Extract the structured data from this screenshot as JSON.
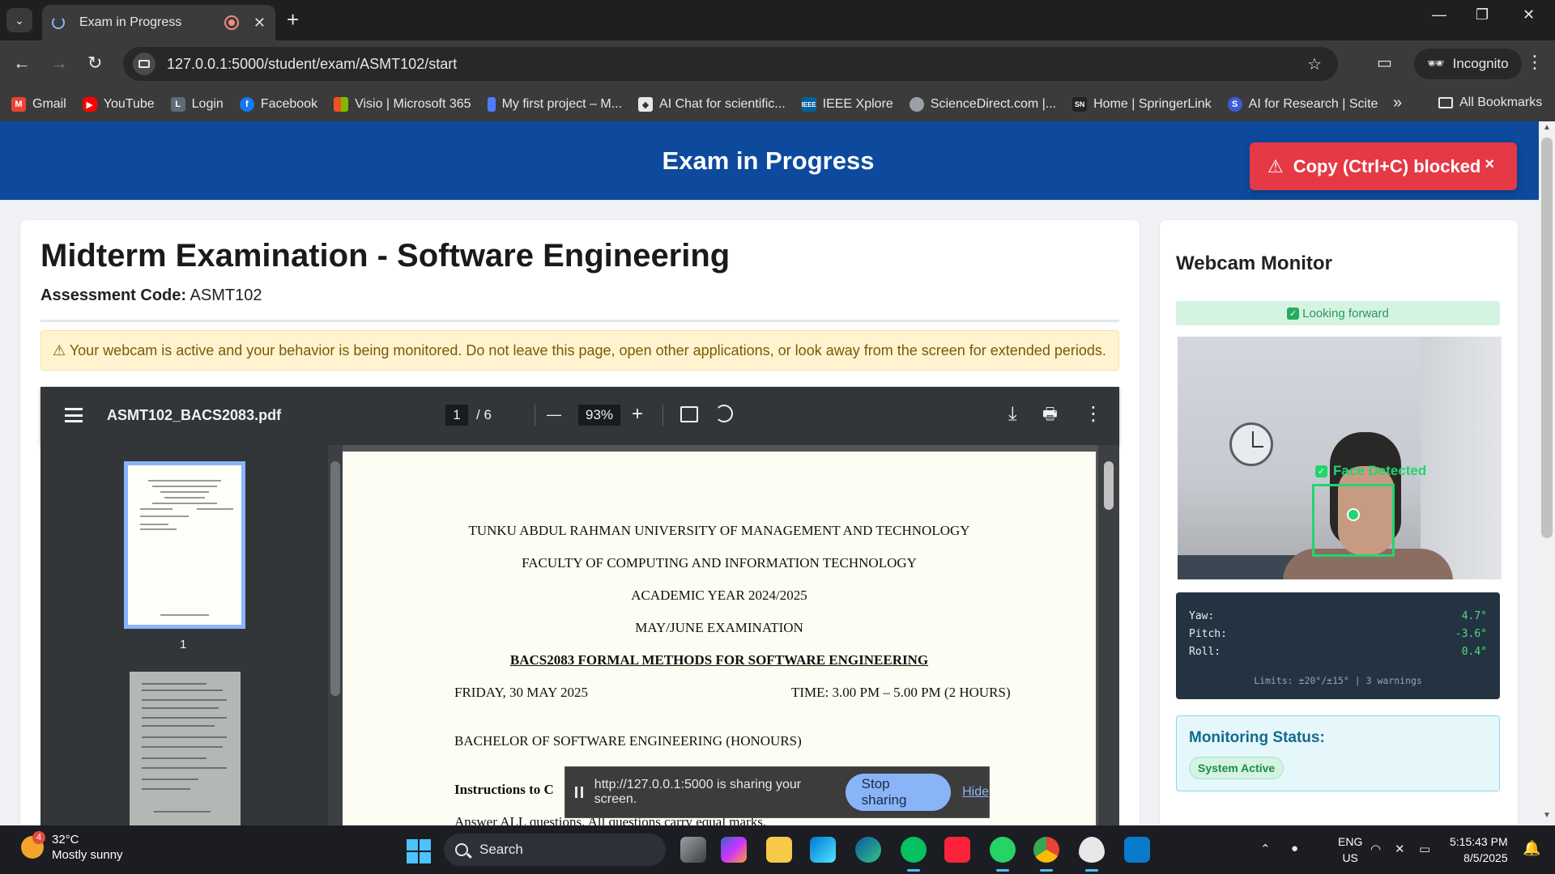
{
  "browser": {
    "tab_title": "Exam in Progress",
    "tab_close": "✕",
    "new_tab": "+",
    "url": "127.0.0.1:5000/student/exam/ASMT102/start",
    "incognito_label": "Incognito",
    "window_controls": [
      "—",
      "❐",
      "✕"
    ],
    "bookmarks": [
      {
        "label": "Gmail",
        "icon": "gmail-icon",
        "color": "#ea4335"
      },
      {
        "label": "YouTube",
        "icon": "youtube-icon",
        "color": "#ff0000"
      },
      {
        "label": "Login",
        "icon": "login-icon",
        "color": "#5f6b7a"
      },
      {
        "label": "Facebook",
        "icon": "facebook-icon",
        "color": "#1877f2"
      },
      {
        "label": "Visio | Microsoft 365",
        "icon": "microsoft-icon",
        "color": "#f25022"
      },
      {
        "label": "My first project – M...",
        "icon": "bookmark-icon",
        "color": "#4f7cff"
      },
      {
        "label": "AI Chat for scientific...",
        "icon": "scispace-icon",
        "color": "#f0f0f0"
      },
      {
        "label": "IEEE Xplore",
        "icon": "ieee-icon",
        "color": "#00629b"
      },
      {
        "label": "ScienceDirect.com |...",
        "icon": "globe-icon",
        "color": "#9aa0a6"
      },
      {
        "label": "Home | SpringerLink",
        "icon": "springer-icon",
        "color": "#222222"
      },
      {
        "label": "AI for Research | Scite",
        "icon": "scite-icon",
        "color": "#3b5bdb"
      }
    ],
    "bookmarks_more": "»",
    "all_bookmarks": "All Bookmarks"
  },
  "page": {
    "header_title": "Exam in Progress",
    "toast_text": "Copy (Ctrl+C) blocked",
    "toast_close": "×",
    "exam_title": "Midterm Examination - Software Engineering",
    "assessment_label": "Assessment Code:",
    "assessment_code": "ASMT102",
    "notice": "⚠ Your webcam is active and your behavior is being monitored. Do not leave this page, open other applications, or look away from the screen for extended periods."
  },
  "pdf": {
    "filename": "ASMT102_BACS2083.pdf",
    "page_current": "1",
    "page_total": "/  6",
    "zoom": "93%",
    "zoom_out": "—",
    "zoom_in": "+",
    "thumb_label": "1",
    "lines": {
      "university": "TUNKU ABDUL RAHMAN UNIVERSITY OF MANAGEMENT AND TECHNOLOGY",
      "faculty": "FACULTY OF COMPUTING AND INFORMATION TECHNOLOGY",
      "year": "ACADEMIC YEAR 2024/2025",
      "exam": "MAY/JUNE EXAMINATION",
      "course": "BACS2083 FORMAL METHODS FOR SOFTWARE ENGINEERING",
      "date": "FRIDAY, 30 MAY 2025",
      "time": "TIME: 3.00 PM – 5.00 PM (2 HOURS)",
      "programme": "BACHELOR OF SOFTWARE ENGINEERING (HONOURS)",
      "instructions": "Instructions to C",
      "answer": "Answer ALL questions. All questions carry equal marks."
    }
  },
  "share": {
    "text": "http://127.0.0.1:5000 is sharing your screen.",
    "stop": "Stop sharing",
    "hide": "Hide"
  },
  "monitor": {
    "title": "Webcam Monitor",
    "gaze_status": "Looking forward",
    "face_label": "Face Detected",
    "yaw_label": "Yaw:",
    "yaw": "4.7°",
    "pitch_label": "Pitch:",
    "pitch": "-3.6°",
    "roll_label": "Roll:",
    "roll": "0.4°",
    "limits": "Limits: ±20°/±15° | 3 warnings",
    "status_title": "Monitoring Status:",
    "status_badge": "System Active"
  },
  "taskbar": {
    "temp": "32°C",
    "weather": "Mostly sunny",
    "weather_badge": "4",
    "search": "Search",
    "lang1": "ENG",
    "lang2": "US",
    "time": "5:15:43 PM",
    "date": "8/5/2025"
  },
  "colors": {
    "header_blue": "#0d4a9e",
    "toast_red": "#e53945",
    "success_green": "#23d56e"
  }
}
